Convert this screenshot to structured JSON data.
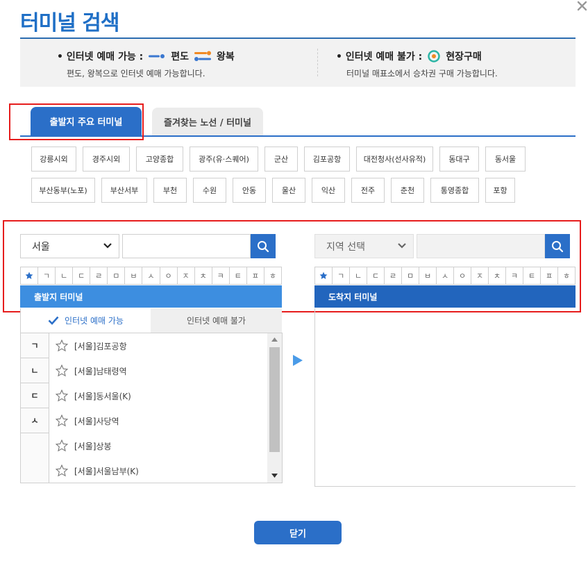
{
  "header": {
    "title": "터미널 검색"
  },
  "info": {
    "online_label": "• 인터넷 예매 가능 :",
    "oneway_label": "편도",
    "roundtrip_label": "왕복",
    "online_desc": "편도, 왕복으로 인터넷 예매 가능합니다.",
    "offline_label": "• 인터넷 예매 불가 :",
    "onsite_label": "현장구매",
    "offline_desc": "터미널 매표소에서 승차권 구매 가능합니다."
  },
  "tabs": {
    "depart": "출발지 주요 터미널",
    "favorites": "즐겨찾는 노선 / 터미널"
  },
  "cities_row1": [
    "강릉시외",
    "경주시외",
    "고양종합",
    "광주(유·스퀘어)",
    "군산",
    "김포공항",
    "대전청사(선사유적)",
    "동대구",
    "동서울"
  ],
  "cities_row2": [
    "부산동부(노포)",
    "부산서부",
    "부천",
    "수원",
    "안동",
    "울산",
    "익산",
    "전주",
    "춘천",
    "통영종합",
    "포항"
  ],
  "departure": {
    "region": "서울",
    "search_value": "",
    "bar_label": "출발지 터미널"
  },
  "arrival": {
    "region": "지역 선택",
    "search_value": "",
    "bar_label": "도착지 터미널"
  },
  "consonants": [
    "ㄱ",
    "ㄴ",
    "ㄷ",
    "ㄹ",
    "ㅁ",
    "ㅂ",
    "ㅅ",
    "ㅇ",
    "ㅈ",
    "ㅊ",
    "ㅋ",
    "ㅌ",
    "ㅍ",
    "ㅎ"
  ],
  "avail_tabs": {
    "on": "인터넷 예매 가능",
    "off": "인터넷 예매 불가"
  },
  "index_consonants": [
    "ㄱ",
    "ㄴ",
    "ㄷ",
    "ㅅ"
  ],
  "terminals": [
    {
      "prefix": "[서울]",
      "name": "김포공항"
    },
    {
      "prefix": "[서울]",
      "name": "남태령역"
    },
    {
      "prefix": "[서울]",
      "name": "동서울(K)"
    },
    {
      "prefix": "[서울]",
      "name": "사당역"
    },
    {
      "prefix": "[서울]",
      "name": "상봉"
    },
    {
      "prefix": "[서울]",
      "name": "서울남부(K)"
    }
  ],
  "footer": {
    "close_label": "닫기"
  },
  "colors": {
    "accent": "#2b6fc8",
    "title": "#1f6fc6",
    "highlight": "#e61c1c",
    "oneway": "#3b78d0",
    "roundtrip_top": "#f08a24",
    "roundtrip_bottom": "#3b78d0",
    "onsite": "#2bb5a5"
  }
}
